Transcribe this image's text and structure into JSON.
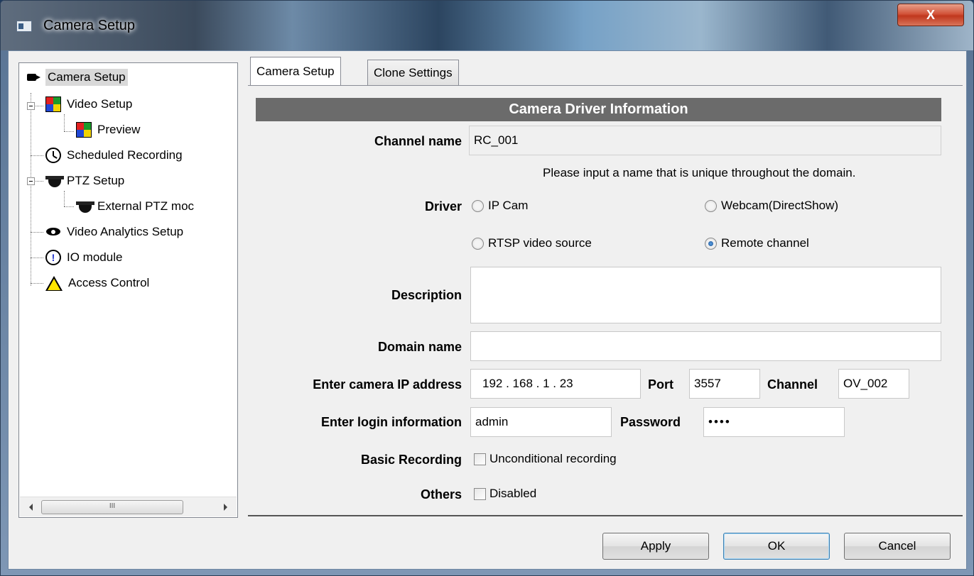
{
  "window": {
    "title": "Camera Setup",
    "close_label": "X"
  },
  "tree": {
    "items": [
      {
        "label": "Camera Setup",
        "icon": "camera-icon"
      },
      {
        "label": "Video Setup",
        "icon": "video-grid-icon"
      },
      {
        "label": "Preview",
        "icon": "preview-grid-icon"
      },
      {
        "label": "Scheduled Recording",
        "icon": "clock-icon"
      },
      {
        "label": "PTZ Setup",
        "icon": "ptz-dome-icon"
      },
      {
        "label": "External PTZ moc",
        "icon": "ptz-dome-icon"
      },
      {
        "label": "Video Analytics Setup",
        "icon": "eye-icon"
      },
      {
        "label": "IO module",
        "icon": "info-icon"
      },
      {
        "label": "Access Control",
        "icon": "warning-icon"
      }
    ],
    "scroll_thumb": "III"
  },
  "tabs": [
    {
      "label": "Camera Setup",
      "active": true
    },
    {
      "label": "Clone Settings",
      "active": false
    }
  ],
  "form": {
    "section_title": "Camera Driver Information",
    "channel_name_label": "Channel name",
    "channel_name_value": "RC_001",
    "channel_hint": "Please input a name that is unique throughout the domain.",
    "driver_label": "Driver",
    "driver_options": [
      {
        "label": "IP Cam",
        "selected": false
      },
      {
        "label": "Webcam(DirectShow)",
        "selected": false
      },
      {
        "label": "RTSP video source",
        "selected": false
      },
      {
        "label": "Remote channel",
        "selected": true
      }
    ],
    "description_label": "Description",
    "description_value": "",
    "domain_name_label": "Domain name",
    "domain_name_value": "",
    "ip_label": "Enter camera IP address",
    "ip_value": "192 . 168 .  1  . 23",
    "port_label": "Port",
    "port_value": "3557",
    "channel_label": "Channel",
    "channel_value": "OV_002",
    "login_label": "Enter login information",
    "login_value": "admin",
    "password_label": "Password",
    "password_value": "••••",
    "basic_recording_label": "Basic Recording",
    "unconditional_label": "Unconditional recording",
    "others_label": "Others",
    "disabled_label": "Disabled"
  },
  "buttons": {
    "apply": "Apply",
    "ok": "OK",
    "cancel": "Cancel"
  }
}
